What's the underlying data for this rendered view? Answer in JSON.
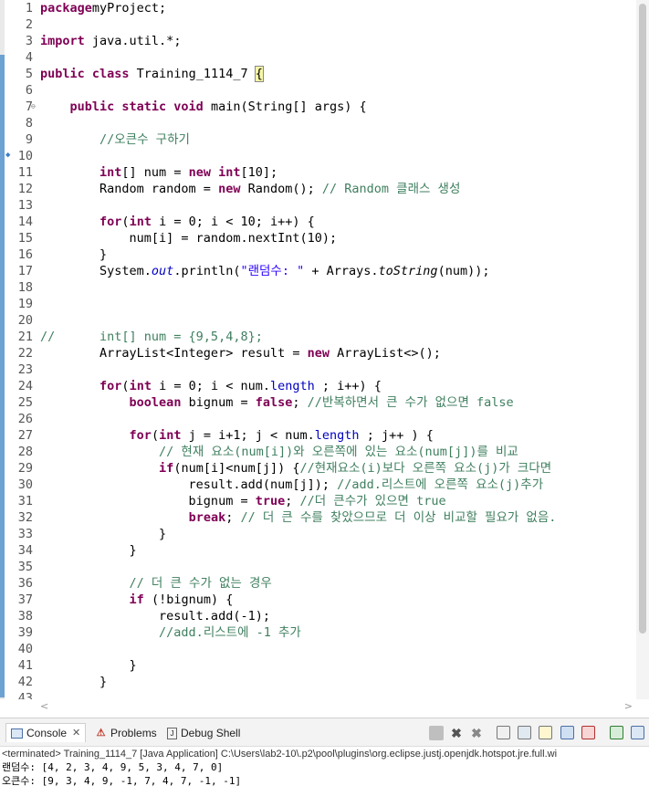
{
  "editor": {
    "lines": [
      {
        "n": "1",
        "segs": [
          [
            "kw",
            "package"
          ],
          [
            "",
            "myProject;"
          ]
        ]
      },
      {
        "n": "2",
        "segs": []
      },
      {
        "n": "3",
        "segs": [
          [
            "kw",
            "import"
          ],
          [
            "",
            " java.util.*;"
          ]
        ]
      },
      {
        "n": "4",
        "segs": []
      },
      {
        "n": "5",
        "segs": [
          [
            "kw",
            "public class"
          ],
          [
            "",
            " Training_1114_7 "
          ],
          [
            "brk",
            "{"
          ]
        ]
      },
      {
        "n": "6",
        "segs": []
      },
      {
        "n": "7",
        "segs": [
          [
            "",
            "    "
          ],
          [
            "kw",
            "public static void"
          ],
          [
            "",
            " main(String[] args) {"
          ]
        ]
      },
      {
        "n": "8",
        "segs": []
      },
      {
        "n": "9",
        "segs": [
          [
            "",
            "        "
          ],
          [
            "cm",
            "//오큰수 구하기"
          ]
        ]
      },
      {
        "n": "10",
        "segs": []
      },
      {
        "n": "11",
        "segs": [
          [
            "",
            "        "
          ],
          [
            "kw",
            "int"
          ],
          [
            "",
            "[] num = "
          ],
          [
            "kw",
            "new int"
          ],
          [
            "",
            "[10];"
          ]
        ]
      },
      {
        "n": "12",
        "segs": [
          [
            "",
            "        Random random = "
          ],
          [
            "kw",
            "new"
          ],
          [
            "",
            " Random(); "
          ],
          [
            "cm",
            "// Random 클래스 생성"
          ]
        ]
      },
      {
        "n": "13",
        "segs": []
      },
      {
        "n": "14",
        "segs": [
          [
            "",
            "        "
          ],
          [
            "kw",
            "for"
          ],
          [
            "",
            "("
          ],
          [
            "kw",
            "int"
          ],
          [
            "",
            " i = 0; i < 10; i++) {"
          ]
        ]
      },
      {
        "n": "15",
        "segs": [
          [
            "",
            "            num[i] = random.nextInt(10);"
          ]
        ]
      },
      {
        "n": "16",
        "segs": [
          [
            "",
            "        }"
          ]
        ]
      },
      {
        "n": "17",
        "segs": [
          [
            "",
            "        System."
          ],
          [
            "fs",
            "out"
          ],
          [
            "",
            ".println("
          ],
          [
            "st",
            "\"랜덤수: \""
          ],
          [
            "",
            " + Arrays."
          ],
          [
            "it",
            "toString"
          ],
          [
            "",
            "(num));"
          ]
        ]
      },
      {
        "n": "18",
        "segs": []
      },
      {
        "n": "19",
        "segs": []
      },
      {
        "n": "20",
        "segs": []
      },
      {
        "n": "21",
        "segs": [
          [
            "cm",
            "//      int[] num = {9,5,4,8};"
          ]
        ]
      },
      {
        "n": "22",
        "segs": [
          [
            "",
            "        ArrayList<Integer> result = "
          ],
          [
            "kw",
            "new"
          ],
          [
            "",
            " ArrayList<>();"
          ]
        ]
      },
      {
        "n": "23",
        "segs": []
      },
      {
        "n": "24",
        "segs": [
          [
            "",
            "        "
          ],
          [
            "kw",
            "for"
          ],
          [
            "",
            "("
          ],
          [
            "kw",
            "int"
          ],
          [
            "",
            " i = 0; i < num."
          ],
          [
            "fd",
            "length"
          ],
          [
            "",
            " ; i++) {"
          ]
        ]
      },
      {
        "n": "25",
        "segs": [
          [
            "",
            "            "
          ],
          [
            "kw",
            "boolean"
          ],
          [
            "",
            " bignum = "
          ],
          [
            "kw",
            "false"
          ],
          [
            "",
            "; "
          ],
          [
            "cm",
            "//반복하면서 큰 수가 없으면 false"
          ]
        ]
      },
      {
        "n": "26",
        "segs": []
      },
      {
        "n": "27",
        "segs": [
          [
            "",
            "            "
          ],
          [
            "kw",
            "for"
          ],
          [
            "",
            "("
          ],
          [
            "kw",
            "int"
          ],
          [
            "",
            " j = i+1; j < num."
          ],
          [
            "fd",
            "length"
          ],
          [
            "",
            " ; j++ ) {"
          ]
        ]
      },
      {
        "n": "28",
        "segs": [
          [
            "",
            "                "
          ],
          [
            "cm",
            "// 현재 요소(num[i])와 오른쪽에 있는 요소(num[j])를 비교"
          ]
        ]
      },
      {
        "n": "29",
        "segs": [
          [
            "",
            "                "
          ],
          [
            "kw",
            "if"
          ],
          [
            "",
            "(num[i]<num[j]) {"
          ],
          [
            "cm",
            "//현재요소(i)보다 오른쪽 요소(j)가 크다면"
          ]
        ]
      },
      {
        "n": "30",
        "segs": [
          [
            "",
            "                    result.add(num[j]); "
          ],
          [
            "cm",
            "//add.리스트에 오른쪽 요소(j)추가"
          ]
        ]
      },
      {
        "n": "31",
        "segs": [
          [
            "",
            "                    bignum = "
          ],
          [
            "kw",
            "true"
          ],
          [
            "",
            "; "
          ],
          [
            "cm",
            "//더 큰수가 있으면 true"
          ]
        ]
      },
      {
        "n": "32",
        "segs": [
          [
            "",
            "                    "
          ],
          [
            "kw",
            "break"
          ],
          [
            "",
            "; "
          ],
          [
            "cm",
            "// 더 큰 수를 찾았으므로 더 이상 비교할 필요가 없음."
          ]
        ]
      },
      {
        "n": "33",
        "segs": [
          [
            "",
            "                }"
          ]
        ]
      },
      {
        "n": "34",
        "segs": [
          [
            "",
            "            }"
          ]
        ]
      },
      {
        "n": "35",
        "segs": []
      },
      {
        "n": "36",
        "segs": [
          [
            "",
            "            "
          ],
          [
            "cm",
            "// 더 큰 수가 없는 경우"
          ]
        ]
      },
      {
        "n": "37",
        "segs": [
          [
            "",
            "            "
          ],
          [
            "kw",
            "if"
          ],
          [
            "",
            " (!bignum) {"
          ]
        ]
      },
      {
        "n": "38",
        "segs": [
          [
            "",
            "                result.add(-1);"
          ]
        ]
      },
      {
        "n": "39",
        "segs": [
          [
            "",
            "                "
          ],
          [
            "cm",
            "//add.리스트에 -1 추가"
          ]
        ]
      },
      {
        "n": "40",
        "segs": []
      },
      {
        "n": "41",
        "segs": [
          [
            "",
            "            }"
          ]
        ]
      },
      {
        "n": "42",
        "segs": [
          [
            "",
            "        }"
          ]
        ]
      },
      {
        "n": "43",
        "segs": []
      }
    ]
  },
  "console_view": {
    "tabs": [
      {
        "label": "Console",
        "icon": "console-icon",
        "active": true
      },
      {
        "label": "Problems",
        "icon": "problems-icon",
        "active": false
      },
      {
        "label": "Debug Shell",
        "icon": "debug-shell-icon",
        "active": false
      }
    ],
    "close_glyph": "✕",
    "terminated_text": "<terminated> Training_1114_7 [Java Application] C:\\Users\\lab2-10\\.p2\\pool\\plugins\\org.eclipse.justj.openjdk.hotspot.jre.full.wi",
    "output": [
      "랜덤수: [4, 2, 3, 4, 9, 5, 3, 4, 7, 0]",
      "오큰수: [9, 3, 4, 9, -1, 7, 4, 7, -1, -1]"
    ]
  },
  "colors": {
    "keyword": "#7f0055",
    "comment": "#3f7f5f",
    "string": "#2a00ff",
    "field": "#0000c0",
    "line_number": "#555555",
    "quick_diff": "#6ca1d3"
  }
}
